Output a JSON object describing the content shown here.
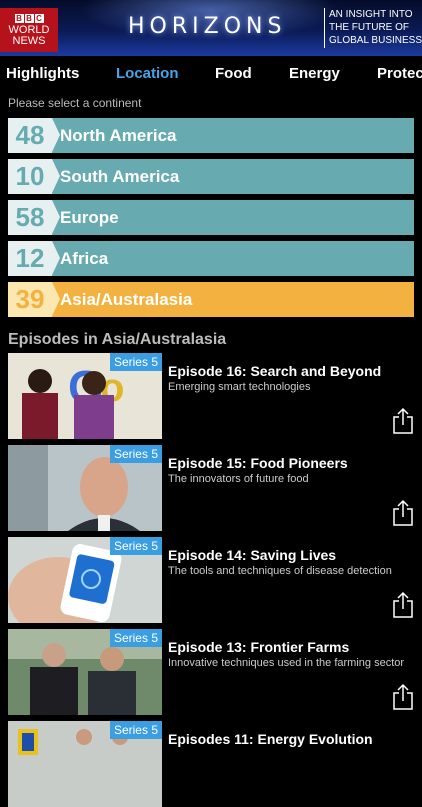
{
  "header": {
    "bbc_letters": [
      "B",
      "B",
      "C"
    ],
    "bbc_line1": "WORLD",
    "bbc_line2": "NEWS",
    "logo": "HORIZONS",
    "tagline": [
      "AN INSIGHT INTO",
      "THE FUTURE OF",
      "GLOBAL BUSINESS"
    ]
  },
  "tabs": [
    {
      "label": "Highlights",
      "active": false
    },
    {
      "label": "Location",
      "active": true
    },
    {
      "label": "Food",
      "active": false
    },
    {
      "label": "Energy",
      "active": false
    },
    {
      "label": "Protec",
      "active": false
    }
  ],
  "prompt": "Please select a continent",
  "continents": [
    {
      "count": "48",
      "name": "North America"
    },
    {
      "count": "10",
      "name": "South America"
    },
    {
      "count": "58",
      "name": "Europe"
    },
    {
      "count": "12",
      "name": "Africa"
    },
    {
      "count": "39",
      "name": "Asia/Australasia"
    }
  ],
  "selected_continent_index": 4,
  "section_title": "Episodes in Asia/Australasia",
  "colors": {
    "accent": "#4aa3e8",
    "continent": "#67abb0",
    "selected": "#f3b23f",
    "badge": "#3a9ee0"
  },
  "episodes": [
    {
      "badge": "Series 5",
      "title": "Episode 16: Search and Beyond",
      "subtitle": "Emerging smart technologies"
    },
    {
      "badge": "Series 5",
      "title": "Episode 15: Food Pioneers",
      "subtitle": "The innovators of future food"
    },
    {
      "badge": "Series 5",
      "title": "Episode 14: Saving Lives",
      "subtitle": "The tools and techniques of disease detection"
    },
    {
      "badge": "Series 5",
      "title": "Episode 13: Frontier Farms",
      "subtitle": "Innovative techniques used in the farming sector"
    },
    {
      "badge": "Series 5",
      "title": "Episodes 11: Energy Evolution",
      "subtitle": ""
    }
  ]
}
